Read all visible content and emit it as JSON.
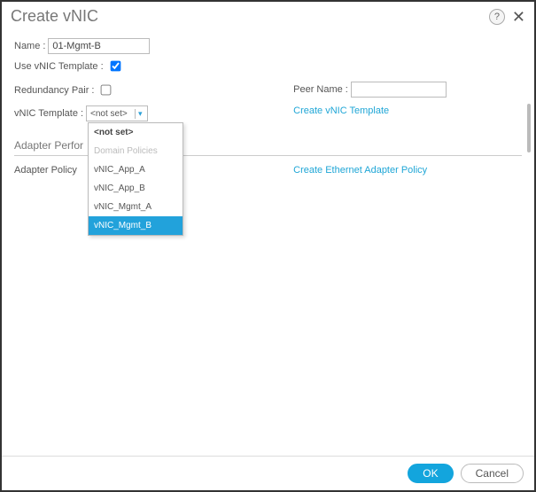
{
  "dialog": {
    "title": "Create vNIC"
  },
  "icons": {
    "help": "?",
    "close": "✕",
    "caret": "▾"
  },
  "form": {
    "name_label": "Name",
    "name_value": "01-Mgmt-B",
    "use_template_label": "Use vNIC Template",
    "use_template_checked": true,
    "redundancy_label": "Redundancy Pair",
    "redundancy_checked": false,
    "peer_label": "Peer Name",
    "peer_value": "",
    "vnic_template_label": "vNIC Template",
    "vnic_template_selected": "<not set>",
    "create_template_link": "Create vNIC Template",
    "adapter_perf_header": "Adapter Perfor",
    "adapter_policy_label": "Adapter Policy",
    "create_adapter_link": "Create Ethernet Adapter Policy"
  },
  "dropdown": {
    "header": "<not set>",
    "disabled": "Domain Policies",
    "opt1": "vNIC_App_A",
    "opt2": "vNIC_App_B",
    "opt3": "vNIC_Mgmt_A",
    "opt4": "vNIC_Mgmt_B"
  },
  "footer": {
    "ok": "OK",
    "cancel": "Cancel"
  }
}
